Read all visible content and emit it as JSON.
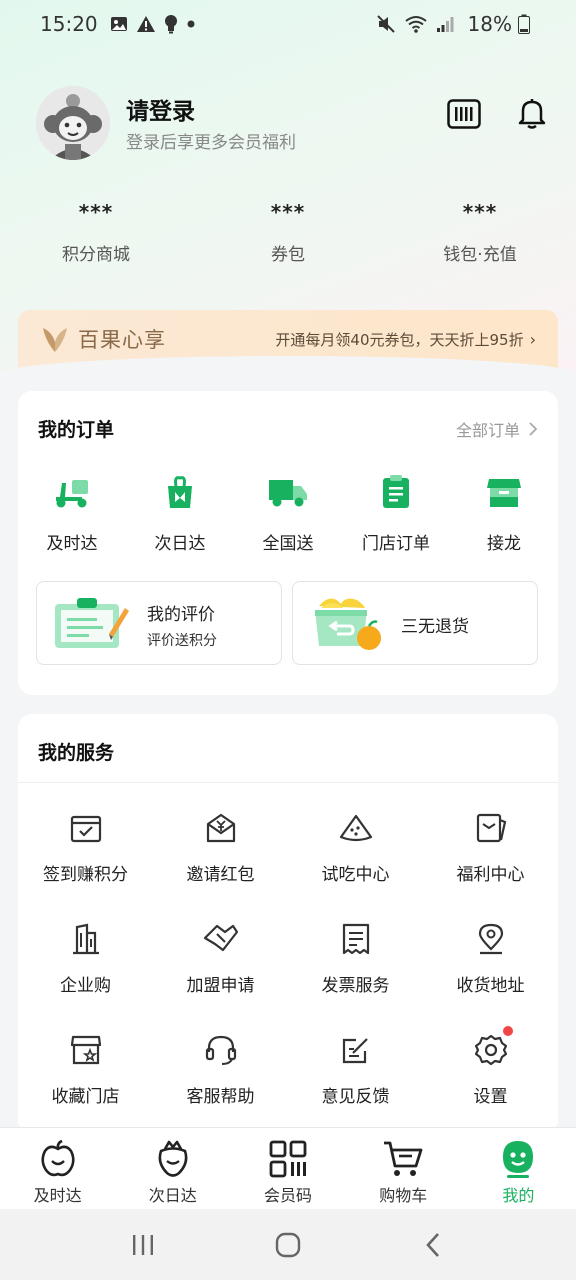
{
  "status_bar": {
    "time": "15:20",
    "battery": "18%"
  },
  "profile": {
    "title": "请登录",
    "subtitle": "登录后享更多会员福利"
  },
  "stats": [
    {
      "value": "***",
      "label": "积分商城"
    },
    {
      "value": "***",
      "label": "券包"
    },
    {
      "value": "***",
      "label": "钱包·充值"
    }
  ],
  "banner": {
    "brand": "百果心享",
    "promo": "开通每月领40元券包，天天折上95折",
    "chevron": "›"
  },
  "orders": {
    "title": "我的订单",
    "all_label": "全部订单",
    "items": [
      {
        "label": "及时达",
        "icon": "scooter-icon"
      },
      {
        "label": "次日达",
        "icon": "bag-icon"
      },
      {
        "label": "全国送",
        "icon": "truck-icon"
      },
      {
        "label": "门店订单",
        "icon": "clipboard-icon"
      },
      {
        "label": "接龙",
        "icon": "store-icon"
      }
    ],
    "review": {
      "title": "我的评价",
      "subtitle": "评价送积分"
    },
    "returns": {
      "title": "三无退货"
    }
  },
  "services": {
    "title": "我的服务",
    "items": [
      {
        "label": "签到赚积分",
        "icon": "calendar-check-icon"
      },
      {
        "label": "邀请红包",
        "icon": "red-envelope-icon"
      },
      {
        "label": "试吃中心",
        "icon": "watermelon-icon"
      },
      {
        "label": "福利中心",
        "icon": "gift-card-icon"
      },
      {
        "label": "企业购",
        "icon": "building-icon"
      },
      {
        "label": "加盟申请",
        "icon": "handshake-icon"
      },
      {
        "label": "发票服务",
        "icon": "receipt-icon"
      },
      {
        "label": "收货地址",
        "icon": "location-pin-icon"
      },
      {
        "label": "收藏门店",
        "icon": "store-star-icon"
      },
      {
        "label": "客服帮助",
        "icon": "headset-icon"
      },
      {
        "label": "意见反馈",
        "icon": "edit-note-icon"
      },
      {
        "label": "设置",
        "icon": "gear-icon"
      }
    ]
  },
  "bottom_nav": [
    {
      "label": "及时达",
      "icon": "apple-icon"
    },
    {
      "label": "次日达",
      "icon": "strawberry-icon"
    },
    {
      "label": "会员码",
      "icon": "qr-code-icon"
    },
    {
      "label": "购物车",
      "icon": "cart-icon"
    },
    {
      "label": "我的",
      "icon": "smile-face-icon",
      "active": true
    }
  ],
  "colors": {
    "accent": "#18b15f",
    "badge": "#f04646"
  }
}
